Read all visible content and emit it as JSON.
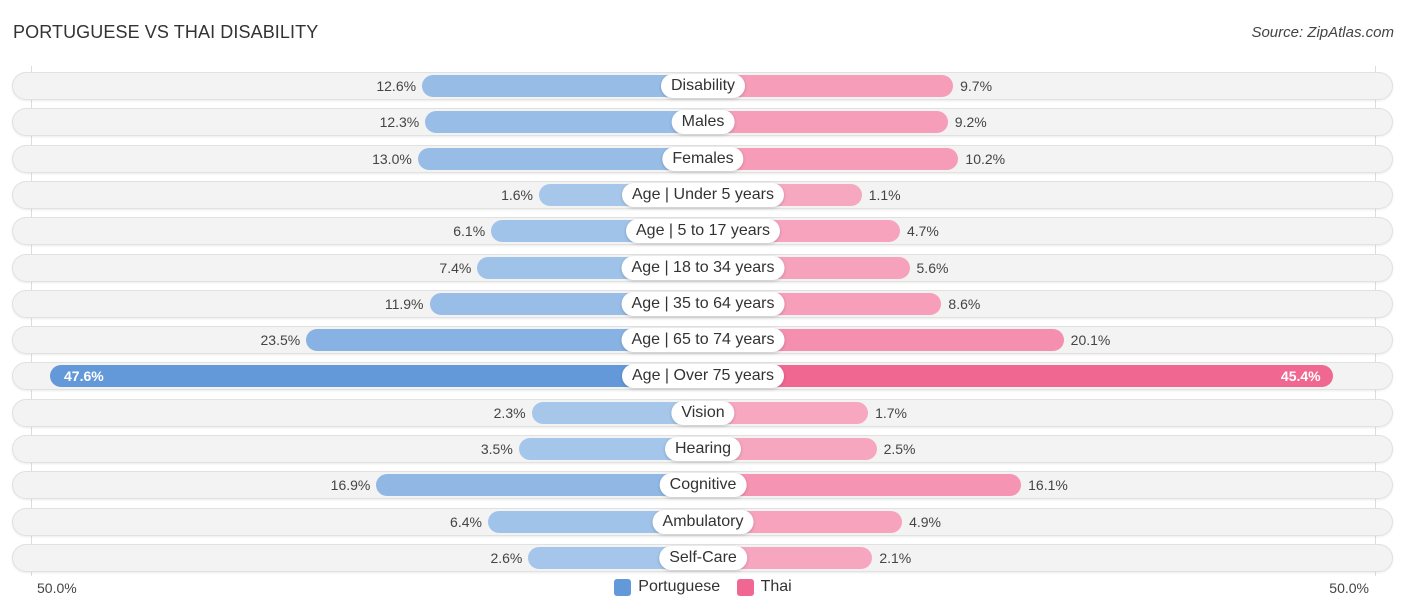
{
  "header": {
    "title": "PORTUGUESE VS THAI DISABILITY",
    "source": "Source: ZipAtlas.com"
  },
  "colors": {
    "portuguese_strong": "#6399d9",
    "portuguese_light": "#a9c9eb",
    "thai_strong": "#f06892",
    "thai_light": "#f7a9c2"
  },
  "chart_data": {
    "type": "bar",
    "orientation": "horizontal-diverging",
    "title": "PORTUGUESE VS THAI DISABILITY",
    "xlabel": "",
    "ylabel": "",
    "xlim_left": "50.0%",
    "xlim_right": "50.0%",
    "axis_max": 50.0,
    "unit": "%",
    "legend_position": "bottom-center",
    "categories": [
      "Disability",
      "Males",
      "Females",
      "Age | Under 5 years",
      "Age | 5 to 17 years",
      "Age | 18 to 34 years",
      "Age | 35 to 64 years",
      "Age | 65 to 74 years",
      "Age | Over 75 years",
      "Vision",
      "Hearing",
      "Cognitive",
      "Ambulatory",
      "Self-Care"
    ],
    "series": [
      {
        "name": "Portuguese",
        "side": "left",
        "values": [
          12.6,
          12.3,
          13.0,
          1.6,
          6.1,
          7.4,
          11.9,
          23.5,
          47.6,
          2.3,
          3.5,
          16.9,
          6.4,
          2.6
        ],
        "labels": [
          "12.6%",
          "12.3%",
          "13.0%",
          "1.6%",
          "6.1%",
          "7.4%",
          "11.9%",
          "23.5%",
          "47.6%",
          "2.3%",
          "3.5%",
          "16.9%",
          "6.4%",
          "2.6%"
        ]
      },
      {
        "name": "Thai",
        "side": "right",
        "values": [
          9.7,
          9.2,
          10.2,
          1.1,
          4.7,
          5.6,
          8.6,
          20.1,
          45.4,
          1.7,
          2.5,
          16.1,
          4.9,
          2.1
        ],
        "labels": [
          "9.7%",
          "9.2%",
          "10.2%",
          "1.1%",
          "4.7%",
          "5.6%",
          "8.6%",
          "20.1%",
          "45.4%",
          "1.7%",
          "2.5%",
          "16.1%",
          "4.9%",
          "2.1%"
        ]
      }
    ]
  },
  "axis": {
    "left_label": "50.0%",
    "right_label": "50.0%"
  },
  "legend": [
    {
      "name": "Portuguese"
    },
    {
      "name": "Thai"
    }
  ]
}
